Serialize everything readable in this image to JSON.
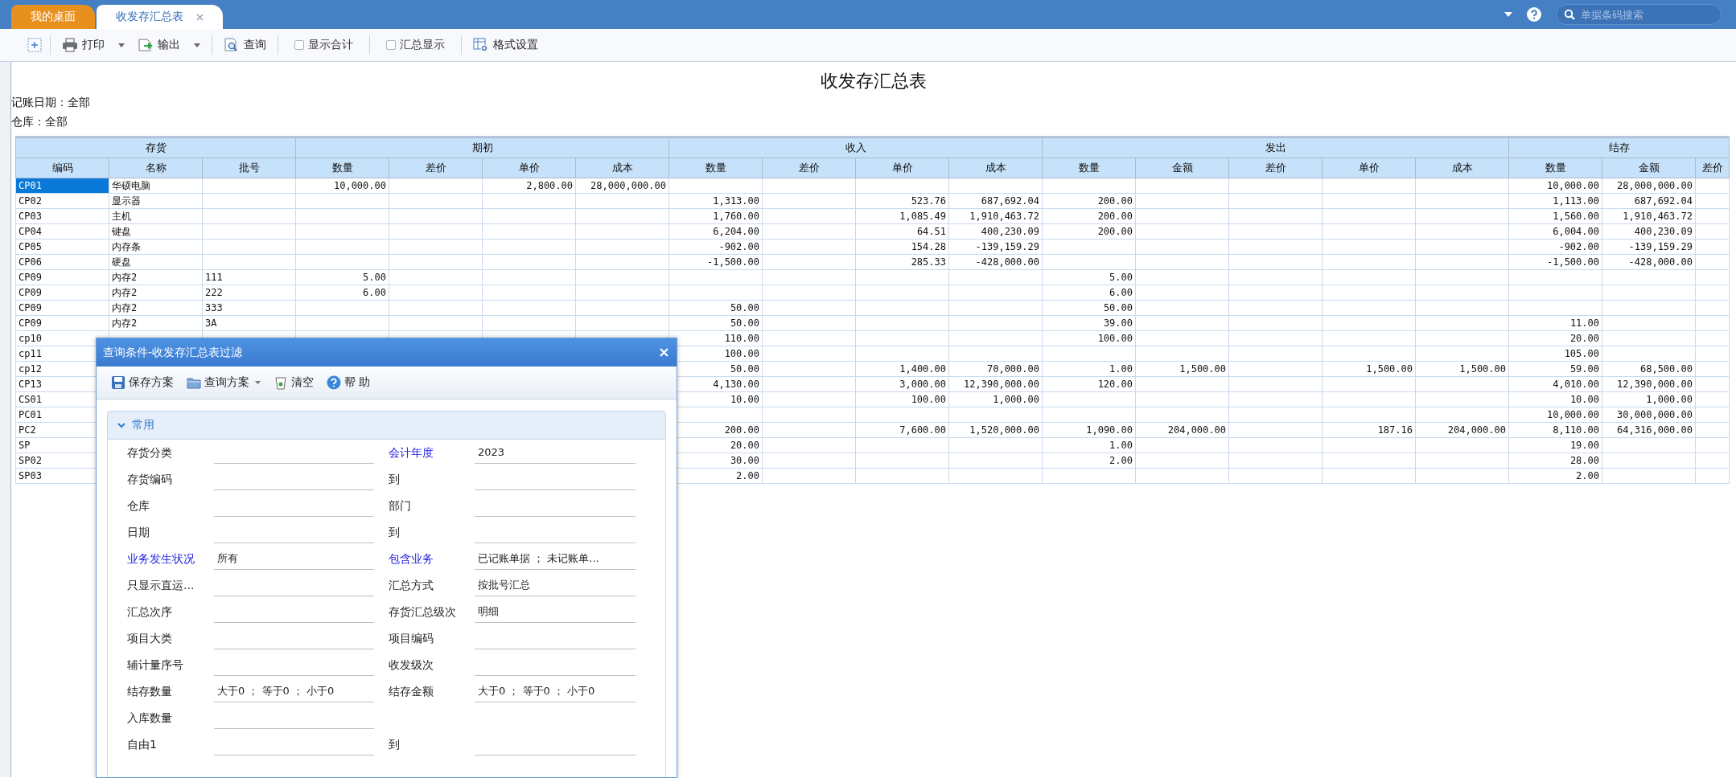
{
  "tabs": [
    {
      "label": "我的桌面",
      "selected": false
    },
    {
      "label": "收发存汇总表",
      "selected": true
    }
  ],
  "search": {
    "placeholder": "单据条码搜索"
  },
  "toolbar": [
    {
      "kind": "icon"
    },
    {
      "kind": "menu",
      "label": "打印"
    },
    {
      "kind": "menu",
      "label": "输出"
    },
    {
      "kind": "button",
      "label": "查询"
    },
    {
      "kind": "checkbox",
      "label": "显示合计",
      "checked": false
    },
    {
      "kind": "checkbox",
      "label": "汇总显示",
      "checked": false
    },
    {
      "kind": "button",
      "label": "格式设置"
    }
  ],
  "report": {
    "title": "收发存汇总表",
    "filters": [
      "记账日期：全部",
      "仓库：全部"
    ],
    "table": {
      "groups": [
        {
          "label": "存货",
          "columns": [
            "编码",
            "名称",
            "批号"
          ]
        },
        {
          "label": "期初",
          "columns": [
            "数量",
            "差价",
            "单价",
            "成本"
          ]
        },
        {
          "label": "收入",
          "columns": [
            "数量",
            "差价",
            "单价",
            "成本"
          ]
        },
        {
          "label": "发出",
          "columns": [
            "数量",
            "金额",
            "差价",
            "单价",
            "成本"
          ]
        },
        {
          "label": "结存",
          "columns": [
            "数量",
            "金额",
            "差价"
          ]
        }
      ],
      "rows": [
        {
          "selected": true,
          "cells": [
            "CP01",
            "华硕电脑",
            null,
            "10,000.00",
            null,
            "2,800.00",
            "28,000,000.00",
            null,
            null,
            null,
            null,
            null,
            null,
            null,
            null,
            null,
            "10,000.00",
            "28,000,000.00",
            null
          ]
        },
        {
          "selected": false,
          "cells": [
            "CP02",
            "显示器",
            null,
            null,
            null,
            null,
            null,
            "1,313.00",
            null,
            "523.76",
            "687,692.04",
            "200.00",
            null,
            null,
            null,
            null,
            "1,113.00",
            "687,692.04",
            null
          ]
        },
        {
          "selected": false,
          "cells": [
            "CP03",
            "主机",
            null,
            null,
            null,
            null,
            null,
            "1,760.00",
            null,
            "1,085.49",
            "1,910,463.72",
            "200.00",
            null,
            null,
            null,
            null,
            "1,560.00",
            "1,910,463.72",
            null
          ]
        },
        {
          "selected": false,
          "cells": [
            "CP04",
            "键盘",
            null,
            null,
            null,
            null,
            null,
            "6,204.00",
            null,
            "64.51",
            "400,230.09",
            "200.00",
            null,
            null,
            null,
            null,
            "6,004.00",
            "400,230.09",
            null
          ]
        },
        {
          "selected": false,
          "cells": [
            "CP05",
            "内存条",
            null,
            null,
            null,
            null,
            null,
            "-902.00",
            null,
            "154.28",
            "-139,159.29",
            null,
            null,
            null,
            null,
            null,
            "-902.00",
            "-139,159.29",
            null
          ]
        },
        {
          "selected": false,
          "cells": [
            "CP06",
            "硬盘",
            null,
            null,
            null,
            null,
            null,
            "-1,500.00",
            null,
            "285.33",
            "-428,000.00",
            null,
            null,
            null,
            null,
            null,
            "-1,500.00",
            "-428,000.00",
            null
          ]
        },
        {
          "selected": false,
          "cells": [
            "CP09",
            "内存2",
            "111",
            "5.00",
            null,
            null,
            null,
            null,
            null,
            null,
            null,
            "5.00",
            null,
            null,
            null,
            null,
            null,
            null,
            null
          ]
        },
        {
          "selected": false,
          "cells": [
            "CP09",
            "内存2",
            "222",
            "6.00",
            null,
            null,
            null,
            null,
            null,
            null,
            null,
            "6.00",
            null,
            null,
            null,
            null,
            null,
            null,
            null
          ]
        },
        {
          "selected": false,
          "cells": [
            "CP09",
            "内存2",
            "333",
            null,
            null,
            null,
            null,
            "50.00",
            null,
            null,
            null,
            "50.00",
            null,
            null,
            null,
            null,
            null,
            null,
            null
          ]
        },
        {
          "selected": false,
          "cells": [
            "CP09",
            "内存2",
            "3A",
            null,
            null,
            null,
            null,
            "50.00",
            null,
            null,
            null,
            "39.00",
            null,
            null,
            null,
            null,
            "11.00",
            null,
            null
          ]
        },
        {
          "selected": false,
          "cells": [
            "cp10",
            null,
            null,
            null,
            null,
            null,
            null,
            "110.00",
            null,
            null,
            null,
            "100.00",
            null,
            null,
            null,
            null,
            "20.00",
            null,
            null
          ]
        },
        {
          "selected": false,
          "cells": [
            "cp11",
            null,
            null,
            null,
            null,
            null,
            null,
            "100.00",
            null,
            null,
            null,
            null,
            null,
            null,
            null,
            null,
            "105.00",
            null,
            null
          ]
        },
        {
          "selected": false,
          "cells": [
            "cp12",
            null,
            null,
            null,
            null,
            null,
            null,
            "50.00",
            null,
            "1,400.00",
            "70,000.00",
            "1.00",
            "1,500.00",
            null,
            "1,500.00",
            "1,500.00",
            "59.00",
            "68,500.00",
            null
          ]
        },
        {
          "selected": false,
          "cells": [
            "CP13",
            null,
            null,
            null,
            null,
            null,
            null,
            "4,130.00",
            null,
            "3,000.00",
            "12,390,000.00",
            "120.00",
            null,
            null,
            null,
            null,
            "4,010.00",
            "12,390,000.00",
            null
          ]
        },
        {
          "selected": false,
          "cells": [
            "CS01",
            null,
            null,
            null,
            null,
            null,
            null,
            "10.00",
            null,
            "100.00",
            "1,000.00",
            null,
            null,
            null,
            null,
            null,
            "10.00",
            "1,000.00",
            null
          ]
        },
        {
          "selected": false,
          "cells": [
            "PC01",
            null,
            null,
            null,
            null,
            null,
            null,
            null,
            null,
            null,
            null,
            null,
            null,
            null,
            null,
            null,
            "10,000.00",
            "30,000,000.00",
            null
          ]
        },
        {
          "selected": false,
          "cells": [
            "PC2",
            null,
            null,
            null,
            null,
            null,
            null,
            "200.00",
            null,
            "7,600.00",
            "1,520,000.00",
            "1,090.00",
            "204,000.00",
            null,
            "187.16",
            "204,000.00",
            "8,110.00",
            "64,316,000.00",
            null
          ]
        },
        {
          "selected": false,
          "cells": [
            "SP",
            null,
            null,
            null,
            null,
            null,
            null,
            "20.00",
            null,
            null,
            null,
            "1.00",
            null,
            null,
            null,
            null,
            "19.00",
            null,
            null
          ]
        },
        {
          "selected": false,
          "cells": [
            "SP02",
            null,
            null,
            null,
            null,
            null,
            null,
            "30.00",
            null,
            null,
            null,
            "2.00",
            null,
            null,
            null,
            null,
            "28.00",
            null,
            null
          ]
        },
        {
          "selected": false,
          "cells": [
            "SP03",
            null,
            null,
            null,
            null,
            null,
            null,
            "2.00",
            null,
            null,
            null,
            null,
            null,
            null,
            null,
            null,
            "2.00",
            null,
            null
          ]
        }
      ]
    }
  },
  "dialog": {
    "title": "查询条件-收发存汇总表过滤",
    "tools": [
      {
        "label": "保存方案",
        "menu": false
      },
      {
        "label": "查询方案",
        "menu": true
      },
      {
        "label": "清空",
        "menu": false
      },
      {
        "label": "帮 助",
        "menu": false
      }
    ],
    "section": {
      "label": "常用",
      "expanded": true
    },
    "rows": [
      {
        "left": {
          "label": "存货分类",
          "required": false
        },
        "right": {
          "label": "会计年度",
          "required": true,
          "value": "2023"
        }
      },
      {
        "left": {
          "label": "存货编码",
          "required": false
        },
        "right": {
          "label": "到",
          "required": false
        }
      },
      {
        "left": {
          "label": "仓库",
          "required": false
        },
        "right": {
          "label": "部门",
          "required": false
        }
      },
      {
        "left": {
          "label": "日期",
          "required": false
        },
        "right": {
          "label": "到",
          "required": false
        }
      },
      {
        "left": {
          "label": "业务发生状况",
          "required": true,
          "value": "所有"
        },
        "right": {
          "label": "包含业务",
          "required": true,
          "value": "已记账单据 ； 未记账单..."
        }
      },
      {
        "left": {
          "label": "只显示直运...",
          "required": false
        },
        "right": {
          "label": "汇总方式",
          "required": false,
          "value": "按批号汇总"
        }
      },
      {
        "left": {
          "label": "汇总次序",
          "required": false
        },
        "right": {
          "label": "存货汇总级次",
          "required": false,
          "value": "明细"
        }
      },
      {
        "left": {
          "label": "项目大类",
          "required": false
        },
        "right": {
          "label": "项目编码",
          "required": false
        }
      },
      {
        "left": {
          "label": "辅计量序号",
          "required": false
        },
        "right": {
          "label": "收发级次",
          "required": false
        }
      },
      {
        "left": {
          "label": "结存数量",
          "required": false,
          "value": "大于0 ； 等于0 ； 小于0"
        },
        "right": {
          "label": "结存金额",
          "required": false,
          "value": "大于0 ； 等于0 ； 小于0"
        }
      },
      {
        "left": {
          "label": "入库数量",
          "required": false
        }
      },
      {
        "left": {
          "label": "自由1",
          "required": false
        },
        "right": {
          "label": "到",
          "required": false
        }
      }
    ]
  }
}
